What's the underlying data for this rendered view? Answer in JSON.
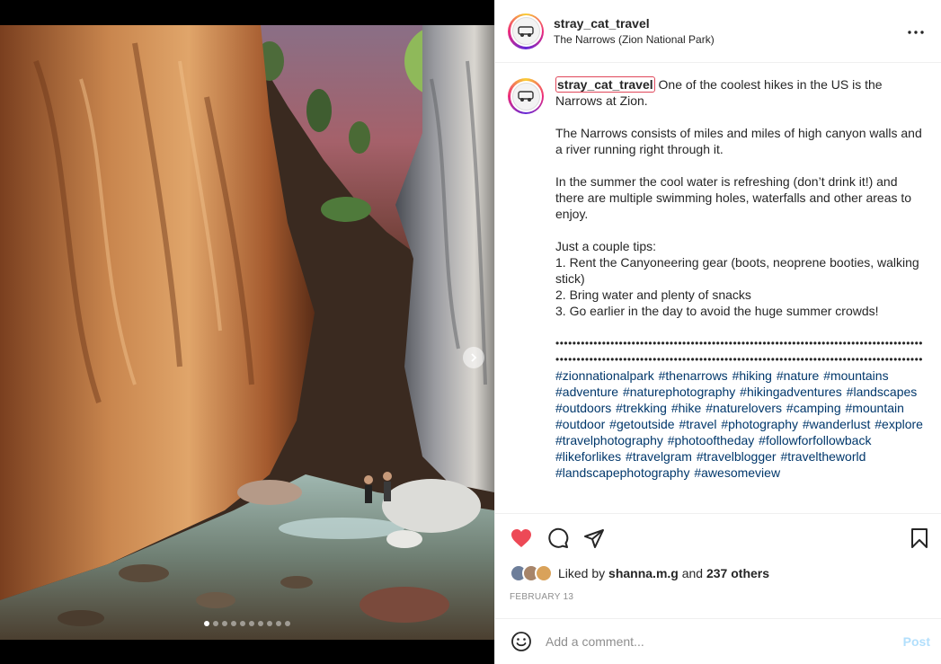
{
  "post": {
    "username": "stray_cat_travel",
    "location": "The Narrows (Zion National Park)",
    "more_icon": "more-horizontal-icon",
    "carousel": {
      "slide_count": 10,
      "active_index": 0
    }
  },
  "caption": {
    "username": "stray_cat_travel",
    "first_line": "One of the coolest hikes in the US is the Narrows at Zion.",
    "para2": "The Narrows consists of miles and miles of high canyon walls and a river running right through it.",
    "para3": "In the summer the cool water is refreshing (don’t drink it!) and there are multiple swimming holes, waterfalls and other areas to enjoy.",
    "tips_title": "Just a couple tips:",
    "tip1": "1. Rent the Canyoneering gear (boots, neoprene booties, walking stick)",
    "tip2": "2. Bring water and plenty of snacks",
    "tip3": "3. Go earlier in the day to avoid the huge summer crowds!",
    "dots": "••••••••••••••••••••••••••••••••••••••••••••••••••••••••••••••••••••••••••••••••••••••••••••••••••••••••••••••••••••••••••••••••••••••••••••••••••••••••••••••••••••••••••••••",
    "hashtags": "#zionnationalpark #thenarrows #hiking #nature #mountains #adventure #naturephotography #hikingadventures #landscapes #outdoors #trekking #hike #naturelovers #camping #mountain #outdoor #getoutside #travel #photography #wanderlust #explore #travelphotography #photooftheday #followforfollowback #likeforlikes #travelgram #travelblogger #traveltheworld #landscapephotography #awesomeview"
  },
  "actions": {
    "like_icon": "heart-filled-icon",
    "comment_icon": "comment-icon",
    "share_icon": "send-icon",
    "save_icon": "bookmark-icon",
    "like_color": "#ed4956"
  },
  "likes": {
    "prefix": "Liked by ",
    "user": "shanna.m.g",
    "middle": " and ",
    "others": "237 others"
  },
  "date": "FEBRUARY 13",
  "comment": {
    "placeholder": "Add a comment...",
    "post_label": "Post",
    "emoji_icon": "emoji-icon"
  }
}
